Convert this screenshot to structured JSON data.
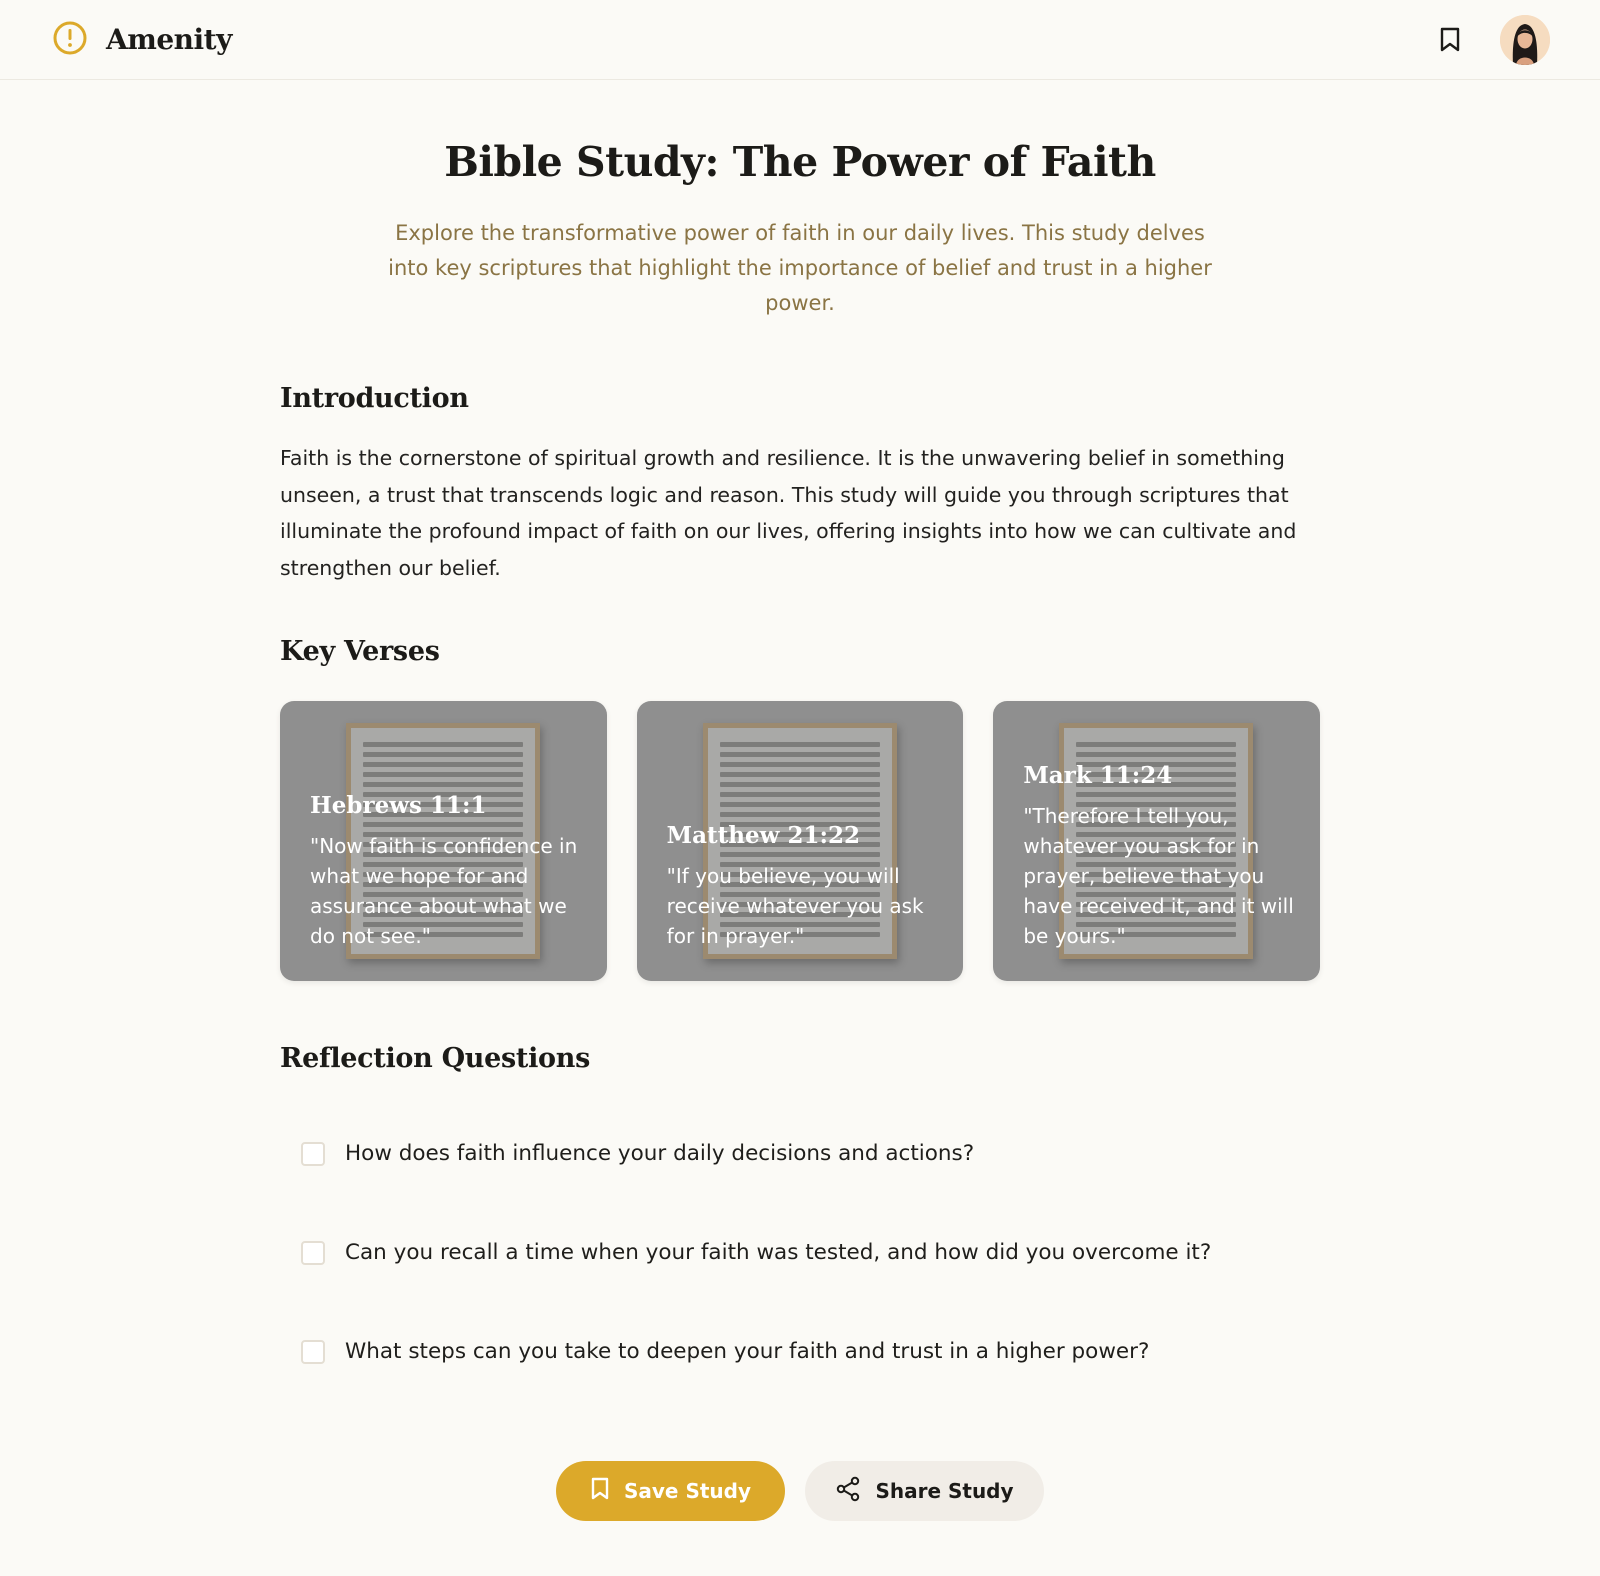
{
  "app": {
    "name": "Amenity"
  },
  "colors": {
    "accent": "#dca92a",
    "subtitle": "#8a7444",
    "background": "#fbfaf6"
  },
  "header": {
    "bookmark_icon": "bookmark-icon",
    "avatar": "user-avatar"
  },
  "page": {
    "title": "Bible Study: The Power of Faith",
    "subtitle": "Explore the transformative power of faith in our daily lives. This study delves into key scriptures that highlight the importance of belief and trust in a higher power."
  },
  "introduction": {
    "title": "Introduction",
    "text": "Faith is the cornerstone of spiritual growth and resilience. It is the unwavering belief in something unseen, a trust that transcends logic and reason. This study will guide you through scriptures that illuminate the profound impact of faith on our lives, offering insights into how we can cultivate and strengthen our belief."
  },
  "verses": {
    "title": "Key Verses",
    "items": [
      {
        "reference": "Hebrews 11:1",
        "quote": "\"Now faith is confidence in what we hope for and assurance about what we do not see.\""
      },
      {
        "reference": "Matthew 21:22",
        "quote": "\"If you believe, you will receive whatever you ask for in prayer.\""
      },
      {
        "reference": "Mark 11:24",
        "quote": "\"Therefore I tell you, whatever you ask for in prayer, believe that you have received it, and it will be yours.\""
      }
    ]
  },
  "reflection": {
    "title": "Reflection Questions",
    "questions": [
      "How does faith influence your daily decisions and actions?",
      "Can you recall a time when your faith was tested, and how did you overcome it?",
      "What steps can you take to deepen your faith and trust in a higher power?"
    ]
  },
  "actions": {
    "save_label": "Save Study",
    "share_label": "Share Study"
  }
}
